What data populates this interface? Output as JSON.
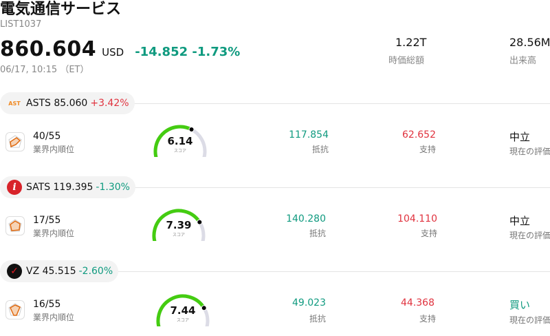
{
  "header": {
    "title": "電気通信サービス",
    "ticker": "LIST1037",
    "price": "860.604",
    "currency": "USD",
    "change": "-14.852 -1.73%",
    "datetime": "06/17, 10:15 （ET）",
    "market_cap_value": "1.22T",
    "market_cap_label": "時価総額",
    "volume_value": "28.56M",
    "volume_label": "出来高"
  },
  "labels": {
    "rank": "業界内順位",
    "score": "スコア",
    "resistance": "抵抗",
    "support": "支持",
    "evaluation": "現在の評価"
  },
  "stocks": [
    {
      "symbol_price": "ASTS 85.060",
      "pct": "+3.42%",
      "direction": "up",
      "logo_text": "AST",
      "rank": "40/55",
      "score": "6.14",
      "score_value": 6.14,
      "resistance": "117.854",
      "support": "62.652",
      "evaluation": "中立",
      "eval_color": "#111111"
    },
    {
      "symbol_price": "SATS 119.395",
      "pct": "-1.30%",
      "direction": "down",
      "logo_text": "i",
      "rank": "17/55",
      "score": "7.39",
      "score_value": 7.39,
      "resistance": "140.280",
      "support": "104.110",
      "evaluation": "中立",
      "eval_color": "#111111"
    },
    {
      "symbol_price": "VZ 45.515",
      "pct": "-2.60%",
      "direction": "down",
      "logo_text": "✓",
      "rank": "16/55",
      "score": "7.44",
      "score_value": 7.44,
      "resistance": "49.023",
      "support": "44.368",
      "evaluation": "買い",
      "eval_color": "#0f9a7f"
    }
  ],
  "colors": {
    "positive": "#0f9a7f",
    "negative": "#e0323e",
    "gauge_fill": "#44cc11",
    "gauge_track": "#dcdce6"
  }
}
